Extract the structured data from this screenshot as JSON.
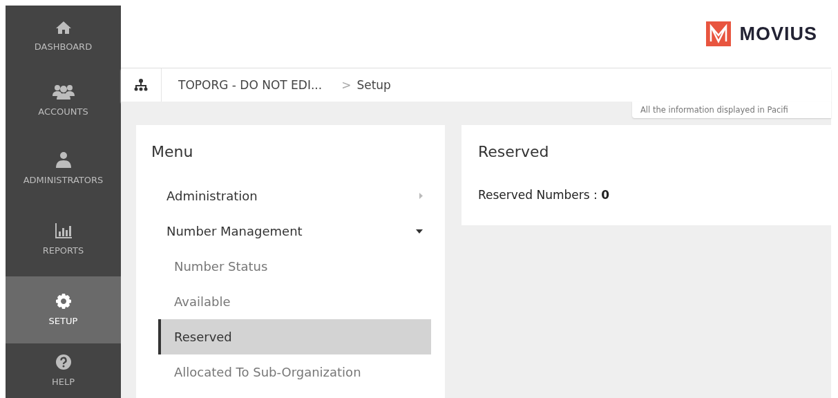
{
  "sidebar": {
    "items": [
      {
        "label": "DASHBOARD",
        "kind": "home",
        "selected": false
      },
      {
        "label": "ACCOUNTS",
        "kind": "users",
        "selected": false
      },
      {
        "label": "ADMINISTRATORS",
        "kind": "admin",
        "selected": false
      },
      {
        "label": "REPORTS",
        "kind": "chart",
        "selected": false
      },
      {
        "label": "SETUP",
        "kind": "gear",
        "selected": true
      },
      {
        "label": "HELP",
        "kind": "help",
        "selected": false
      }
    ]
  },
  "header": {
    "logo": "MOVIUS"
  },
  "breadcrumb": {
    "items": [
      "TOPORG - DO NOT EDI...",
      "Setup"
    ],
    "separator": ">"
  },
  "timezone_note": "All the information displayed in Pacifi",
  "menu": {
    "title": "Menu",
    "items": [
      {
        "label": "Administration",
        "expanded": false
      },
      {
        "label": "Number Management",
        "expanded": true,
        "children": [
          {
            "label": "Number Status",
            "selected": false
          },
          {
            "label": "Available",
            "selected": false
          },
          {
            "label": "Reserved",
            "selected": true
          },
          {
            "label": "Allocated To Sub-Organization",
            "selected": false
          }
        ]
      }
    ]
  },
  "content": {
    "title": "Reserved",
    "summary_label": "Reserved Numbers :",
    "summary_value": "0"
  }
}
